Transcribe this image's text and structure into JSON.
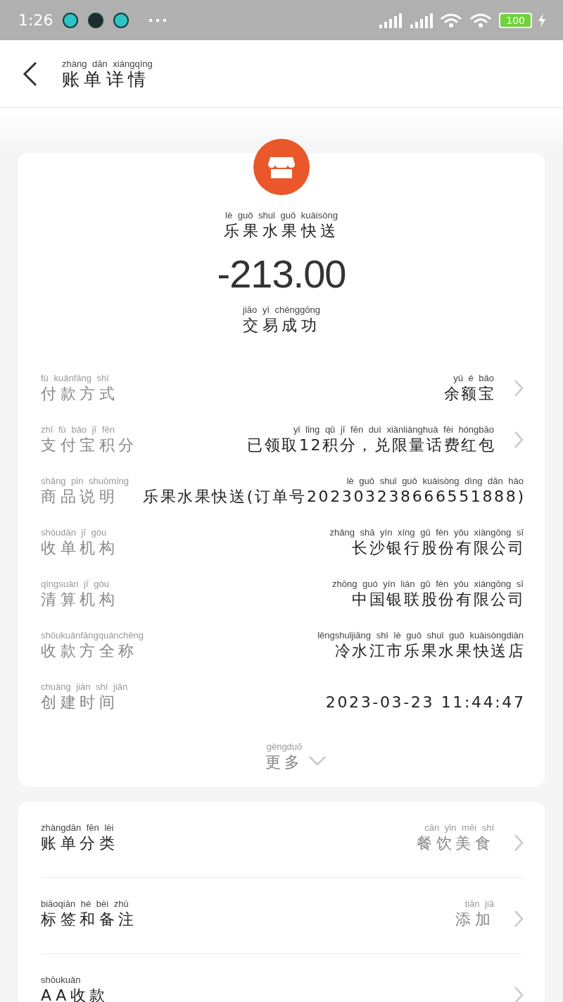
{
  "status_bar": {
    "time": "1:26",
    "battery": "100"
  },
  "header": {
    "title": {
      "pinyin": "zhàng dān xiángqíng",
      "text": "账单详情"
    }
  },
  "merchant": {
    "name": {
      "pinyin": "lè guǒ shuǐ guǒ kuàisòng",
      "text": "乐果水果快送"
    },
    "amount": "-213.00",
    "status": {
      "pinyin": "jiāo yì chénggōng",
      "text": "交易成功"
    }
  },
  "details": [
    {
      "label": {
        "pinyin": "fù kuǎnfāng shì",
        "text": "付款方式"
      },
      "value": {
        "pinyin": "yú é bǎo",
        "text": "余额宝"
      },
      "chevron": true
    },
    {
      "label": {
        "pinyin": "zhī fù bǎo jī fēn",
        "text": "支付宝积分"
      },
      "value": {
        "pinyin": "yǐ lǐng qǔ jī fēn duì xiànliànghuà fèi hóngbāo",
        "text": "已领取12积分，兑限量话费红包"
      },
      "chevron": true
    },
    {
      "label": {
        "pinyin": "shāng pǐn shuōmíng",
        "text": "商品说明"
      },
      "value": {
        "pinyin": "lè guǒ shuǐ guǒ kuàisòng dìng dān hào",
        "text": "乐果水果快送(订单号202303238666551888)"
      },
      "chevron": false
    },
    {
      "label": {
        "pinyin": "shōudān jī gòu",
        "text": "收单机构"
      },
      "value": {
        "pinyin": "zhǎng shā yín xíng gǔ fèn yǒu xiàngōng sī",
        "text": "长沙银行股份有限公司"
      },
      "chevron": false
    },
    {
      "label": {
        "pinyin": "qīngsuàn jī gòu",
        "text": "清算机构"
      },
      "value": {
        "pinyin": "zhōng guó yín lián gǔ fèn yǒu xiàngōng sī",
        "text": "中国银联股份有限公司"
      },
      "chevron": false
    },
    {
      "label": {
        "pinyin": "shōukuǎnfāngquánchēng",
        "text": "收款方全称"
      },
      "value": {
        "pinyin": "lěngshuǐjiāng shì lè guǒ shuǐ guǒ kuàisòngdiàn",
        "text": "冷水江市乐果水果快送店"
      },
      "chevron": false
    },
    {
      "label": {
        "pinyin": "chuàng jiàn shí jiān",
        "text": "创建时间"
      },
      "value": {
        "text": "2023-03-23 11:44:47"
      },
      "chevron": false
    }
  ],
  "more": {
    "pinyin": "gèngduō",
    "text": "更多"
  },
  "options": [
    {
      "label": {
        "pinyin": "zhàngdān fēn lèi",
        "text": "账单分类"
      },
      "value": {
        "pinyin": "cān yǐn měi shí",
        "text": "餐饮美食"
      },
      "chevron": true
    },
    {
      "label": {
        "pinyin": "biāoqiān hé bèi zhù",
        "text": "标签和备注"
      },
      "value": {
        "pinyin": "tiān jiā",
        "text": "添加"
      },
      "chevron": true
    },
    {
      "label": {
        "pinyin": "shōukuǎn",
        "text": "AA收款"
      },
      "chevron": true
    }
  ]
}
